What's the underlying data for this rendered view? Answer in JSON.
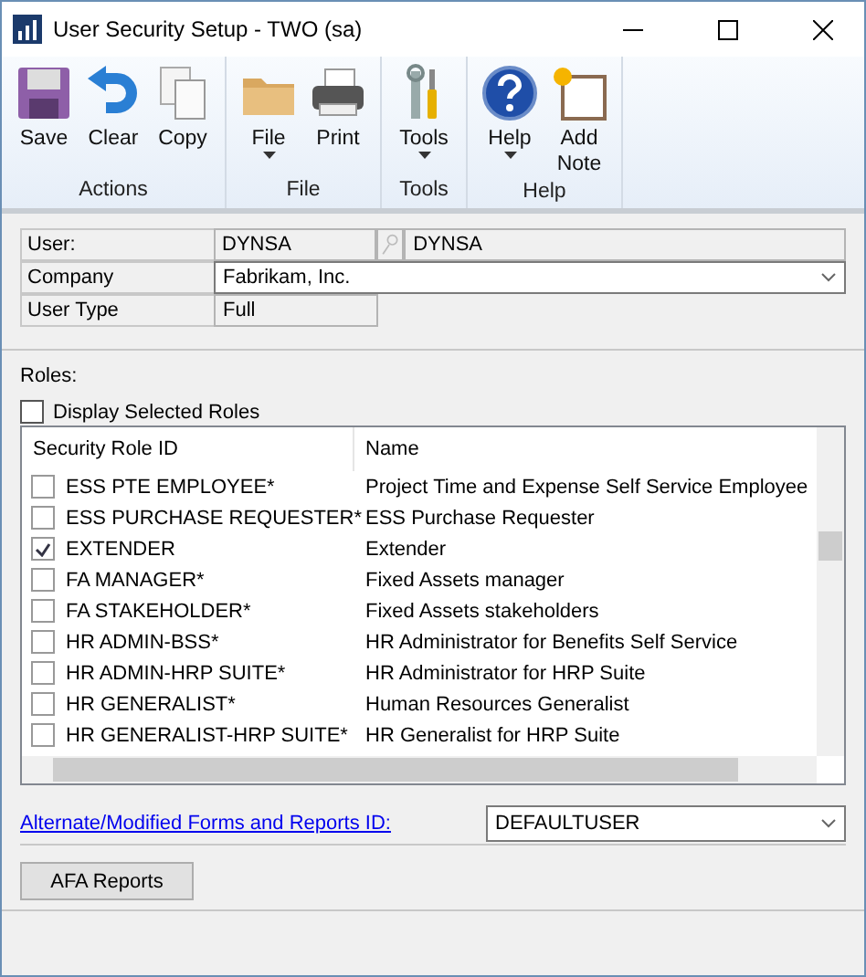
{
  "window": {
    "title": "User Security Setup  -  TWO (sa)"
  },
  "ribbon": {
    "groups": [
      {
        "label": "Actions",
        "buttons": [
          {
            "label": "Save",
            "menu": false
          },
          {
            "label": "Clear",
            "menu": false
          },
          {
            "label": "Copy",
            "menu": false
          }
        ]
      },
      {
        "label": "File",
        "buttons": [
          {
            "label": "File",
            "menu": true
          },
          {
            "label": "Print",
            "menu": false
          }
        ]
      },
      {
        "label": "Tools",
        "buttons": [
          {
            "label": "Tools",
            "menu": true
          }
        ]
      },
      {
        "label": "Help",
        "buttons": [
          {
            "label": "Help",
            "menu": true
          },
          {
            "label": "Add Note",
            "menu": false
          }
        ]
      }
    ]
  },
  "form": {
    "user": {
      "label": "User:",
      "id": "DYNSA",
      "name": "DYNSA"
    },
    "company": {
      "label": "Company",
      "value": "Fabrikam, Inc."
    },
    "user_type": {
      "label": "User Type",
      "value": "Full"
    }
  },
  "roles": {
    "label": "Roles:",
    "display_selected": {
      "label": "Display Selected Roles",
      "checked": false
    },
    "columns": [
      "Security Role ID",
      "Name"
    ],
    "rows": [
      {
        "id": "ESS PTE EMPLOYEE*",
        "name": "Project Time and Expense Self Service Employee",
        "checked": false
      },
      {
        "id": "ESS PURCHASE REQUESTER*",
        "name": "ESS Purchase Requester",
        "checked": false
      },
      {
        "id": "EXTENDER",
        "name": "Extender",
        "checked": true
      },
      {
        "id": "FA MANAGER*",
        "name": "Fixed Assets manager",
        "checked": false
      },
      {
        "id": "FA STAKEHOLDER*",
        "name": "Fixed Assets stakeholders",
        "checked": false
      },
      {
        "id": "HR ADMIN-BSS*",
        "name": "HR Administrator for Benefits Self Service",
        "checked": false
      },
      {
        "id": "HR ADMIN-HRP SUITE*",
        "name": "HR Administrator for HRP Suite",
        "checked": false
      },
      {
        "id": "HR GENERALIST*",
        "name": "Human Resources Generalist",
        "checked": false
      },
      {
        "id": "HR GENERALIST-HRP SUITE*",
        "name": "HR Generalist for HRP Suite",
        "checked": false
      }
    ]
  },
  "alternate": {
    "link": "Alternate/Modified Forms and Reports ID:",
    "value": "DEFAULTUSER"
  },
  "buttons": [
    "AFA Reports"
  ]
}
